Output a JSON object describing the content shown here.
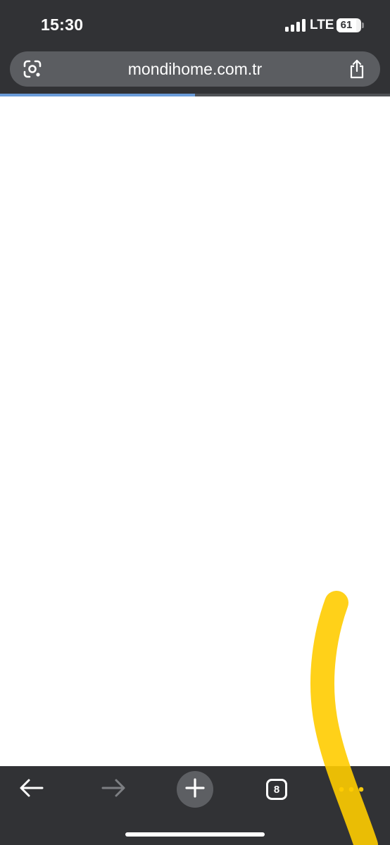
{
  "status_bar": {
    "time": "15:30",
    "network": "LTE",
    "battery_level": "61",
    "signal_bars": 4
  },
  "address_bar": {
    "url": "mondihome.com.tr",
    "left_icon": "google-lens-icon",
    "right_icon": "share-icon"
  },
  "page_load_progress": 0.5,
  "toolbar": {
    "back_icon": "back-arrow-icon",
    "forward_icon": "forward-arrow-icon",
    "new_tab_icon": "plus-icon",
    "tab_count": "8",
    "menu_icon": "more-dots-icon"
  },
  "colors": {
    "chrome_bg": "#313235",
    "address_bg": "#5b5d61",
    "progress": "#6a9bd8",
    "menu_dots": "#f6c90e",
    "highlight_stroke": "#ffcc00"
  }
}
